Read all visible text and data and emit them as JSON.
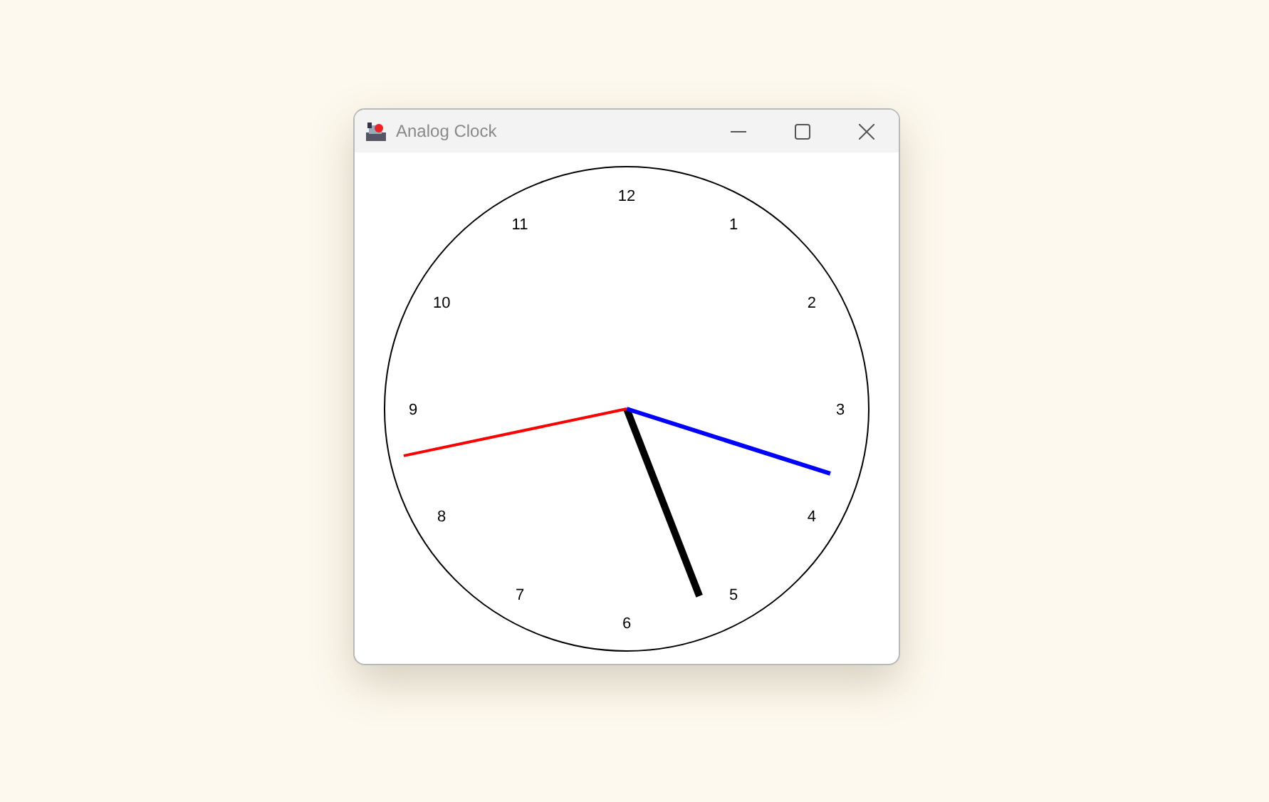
{
  "window": {
    "title": "Analog Clock"
  },
  "clock": {
    "numerals": [
      "12",
      "1",
      "2",
      "3",
      "4",
      "5",
      "6",
      "7",
      "8",
      "9",
      "10",
      "11"
    ],
    "hands": [
      {
        "kind": "hour"
      },
      {
        "kind": "minute"
      },
      {
        "kind": "second"
      }
    ]
  }
}
